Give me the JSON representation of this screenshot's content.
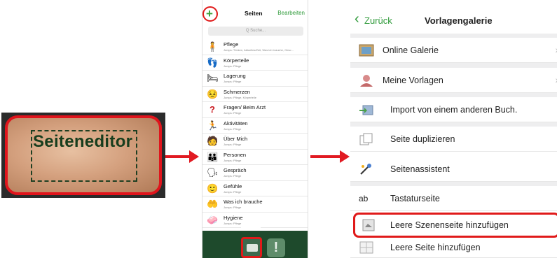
{
  "editor": {
    "label": "Seiteneditor"
  },
  "phone": {
    "plus": "+",
    "title": "Seiten",
    "edit": "Bearbeiten",
    "search_placeholder": "Q Suche...",
    "pages": [
      {
        "name": "Pflege",
        "sub": "Jumps: Trinken, Aktuelles/Zeit, Was ich brauche, Gesc...",
        "icon": "🧍"
      },
      {
        "name": "Körperteile",
        "sub": "Jumps: Pflege",
        "icon": "👣"
      },
      {
        "name": "Lagerung",
        "sub": "Jumps: Pflege",
        "icon": "🛏"
      },
      {
        "name": "Schmerzen",
        "sub": "Jumps: Pflege, Körperteile",
        "icon": "😣"
      },
      {
        "name": "Fragen/ Beim Arzt",
        "sub": "Jumps: Pflege",
        "icon": "?"
      },
      {
        "name": "Aktivitäten",
        "sub": "Jumps: Pflege",
        "icon": "🏃"
      },
      {
        "name": "Über Mich",
        "sub": "Jumps: Pflege",
        "icon": "🧑"
      },
      {
        "name": "Personen",
        "sub": "Jumps: Pflege",
        "icon": "👪"
      },
      {
        "name": "Gespräch",
        "sub": "Jumps: Pflege",
        "icon": "🗣"
      },
      {
        "name": "Gefühle",
        "sub": "Jumps: Pflege",
        "icon": "🙂"
      },
      {
        "name": "Was ich brauche",
        "sub": "Jumps: Pflege",
        "icon": "🤲"
      },
      {
        "name": "Hygiene",
        "sub": "Jumps: Pflege",
        "icon": "🧼"
      }
    ],
    "alert_icon": "!"
  },
  "gallery": {
    "back": "Zurück",
    "title": "Vorlagengalerie",
    "rows": [
      {
        "label": "Online Galerie"
      },
      {
        "label": "Meine Vorlagen"
      },
      {
        "label": "Import von einem anderen Buch."
      },
      {
        "label": "Seite duplizieren"
      },
      {
        "label": "Seitenassistent"
      },
      {
        "label": "Tastaturseite",
        "icon_text": "ab"
      },
      {
        "label": "Leere Szenenseite hinzufügen"
      },
      {
        "label": "Leere Seite hinzufügen"
      }
    ]
  },
  "colors": {
    "highlight": "#e01a1a",
    "accent": "#2f9a3a",
    "toolbar": "#1e4a2c"
  }
}
